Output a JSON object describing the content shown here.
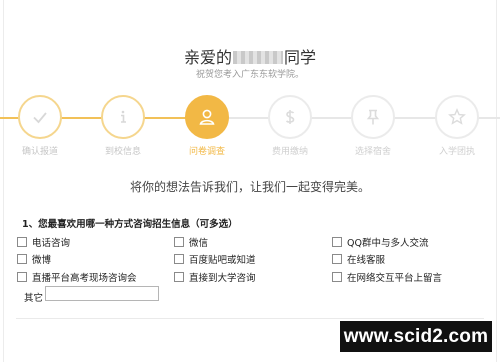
{
  "header": {
    "greeting_prefix": "亲爱的",
    "greeting_suffix": "同学",
    "subtitle": "祝贺您考入广东东软学院。"
  },
  "steps": [
    {
      "label": "确认报道",
      "icon": "check-icon",
      "state": "done"
    },
    {
      "label": "到校信息",
      "icon": "info-icon",
      "state": "done"
    },
    {
      "label": "问卷调查",
      "icon": "user-icon",
      "state": "active"
    },
    {
      "label": "费用缴纳",
      "icon": "dollar-icon",
      "state": "todo"
    },
    {
      "label": "选择宿舍",
      "icon": "pin-icon",
      "state": "todo"
    },
    {
      "label": "入学团执",
      "icon": "star-icon",
      "state": "todo"
    }
  ],
  "survey": {
    "tagline": "将你的想法告诉我们，让我们一起变得完美。",
    "question": "1、您最喜欢用哪一种方式咨询招生信息（可多选）",
    "options": [
      "电话咨询",
      "微信",
      "QQ群中与多人交流",
      "微博",
      "百度贴吧或知道",
      "在线客服",
      "直播平台高考现场咨询会",
      "直接到大学咨询",
      "在网络交互平台上留言"
    ],
    "other_label": "其它",
    "other_value": ""
  },
  "watermark": "www.scid2.com",
  "colors": {
    "accent": "#f2b845",
    "done_ring": "#f5d68e",
    "todo_ring": "#ebebeb"
  }
}
